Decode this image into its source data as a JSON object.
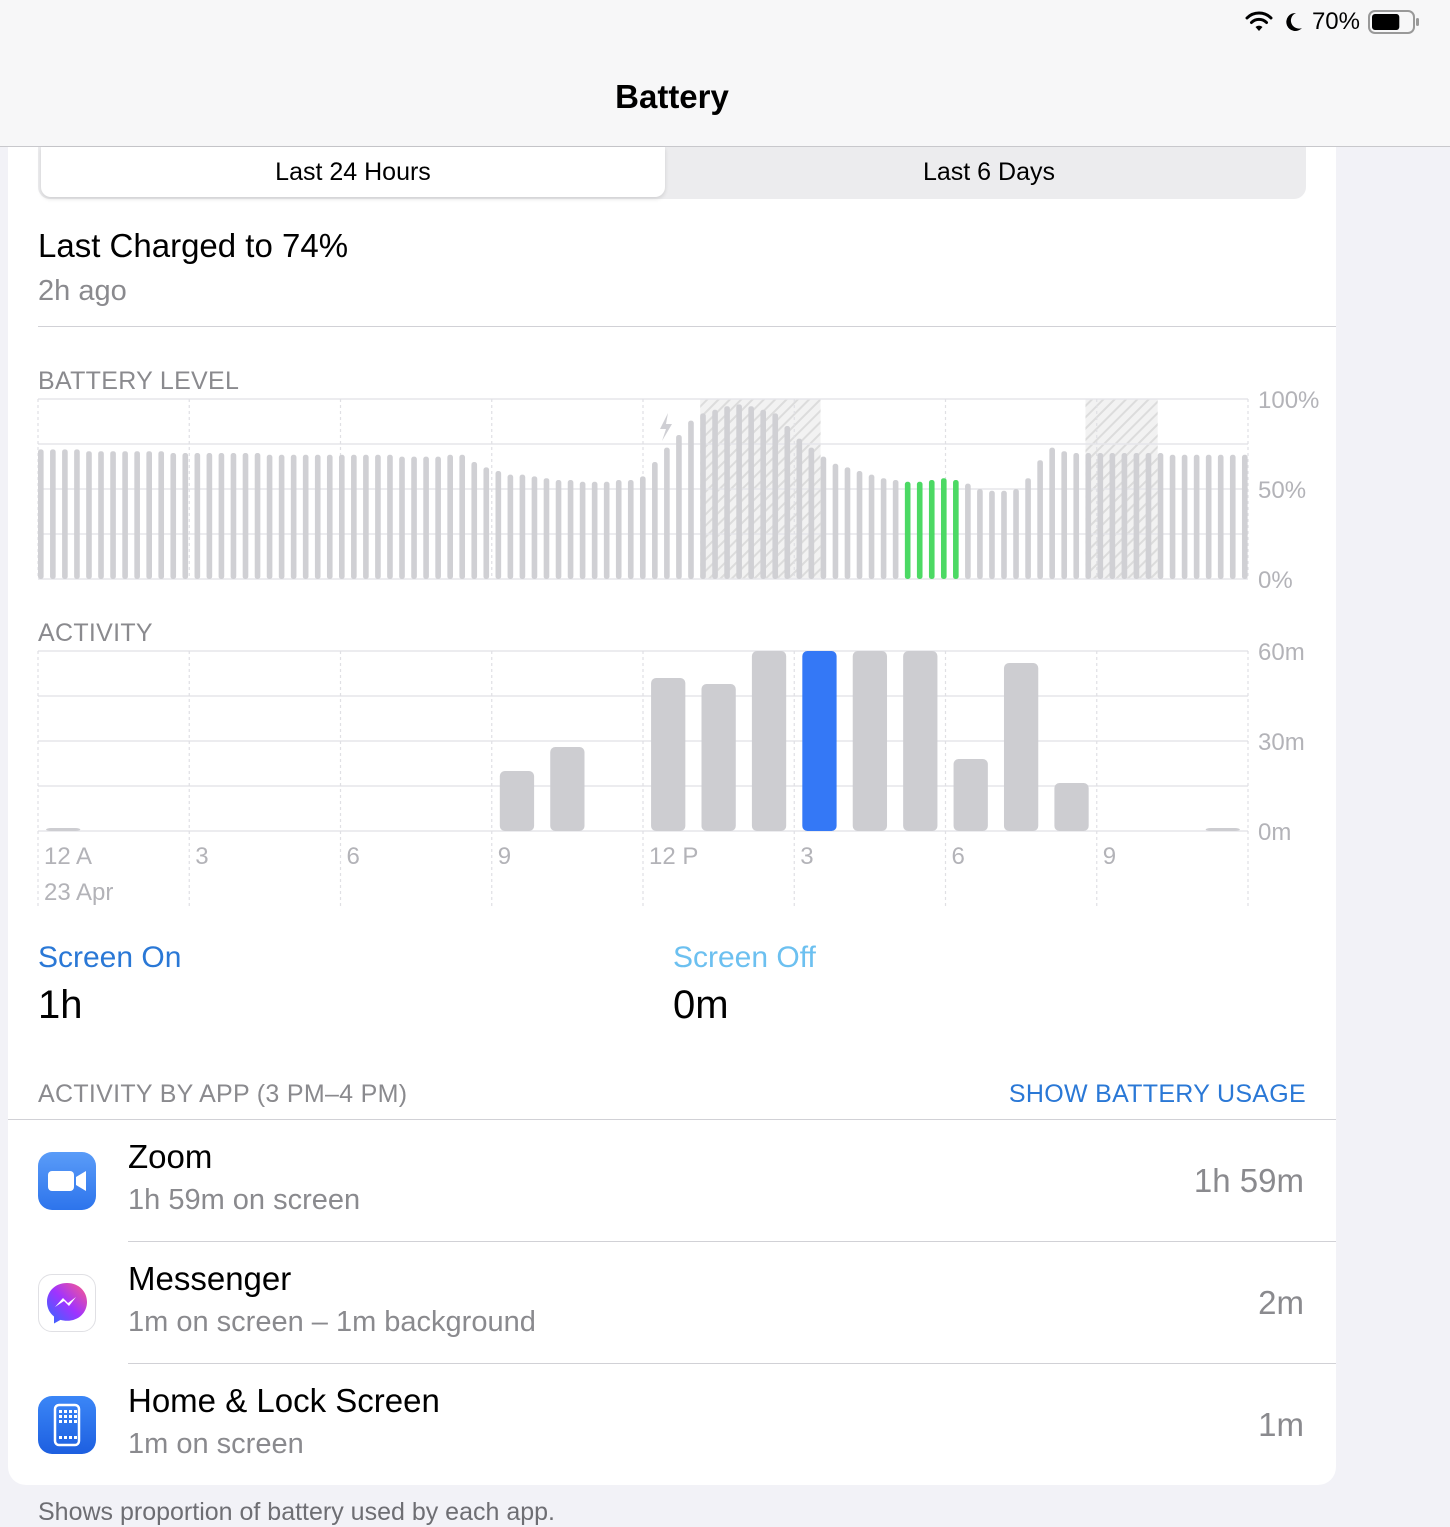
{
  "status_bar": {
    "battery_percent": "70%",
    "battery_level": 0.7,
    "icons": [
      "wifi-icon",
      "moon-icon",
      "battery-icon"
    ]
  },
  "navbar": {
    "title": "Battery"
  },
  "segments": {
    "active": "Last 24 Hours",
    "inactive": "Last 6 Days"
  },
  "last_charged": {
    "title": "Last Charged to 74%",
    "subtitle": "2h ago"
  },
  "battery_level": {
    "label": "BATTERY LEVEL",
    "y_ticks": [
      "100%",
      "50%",
      "0%"
    ]
  },
  "activity": {
    "label": "ACTIVITY",
    "y_ticks": [
      "60m",
      "30m",
      "0m"
    ],
    "x_ticks": [
      "12 A",
      "3",
      "6",
      "9",
      "12 P",
      "3",
      "6",
      "9"
    ],
    "date_label": "23 Apr"
  },
  "chart_data": [
    {
      "type": "bar",
      "name": "battery_level",
      "ylim": [
        0,
        100
      ],
      "unit": "%",
      "values": [
        72,
        72,
        72,
        72,
        72,
        72,
        72,
        71,
        71,
        71,
        71,
        71,
        71,
        71,
        71,
        71,
        71,
        71,
        71,
        71,
        71,
        71,
        70,
        70,
        70,
        70,
        70,
        70,
        70,
        70,
        70,
        70,
        70,
        70,
        70,
        70,
        70,
        70,
        69,
        69,
        69,
        69,
        69,
        69,
        69,
        69,
        69,
        69,
        69,
        69,
        69,
        69,
        69,
        69,
        69,
        69,
        69,
        69,
        69,
        69,
        68,
        68,
        68,
        68,
        68,
        68,
        68,
        68,
        69,
        69,
        69,
        67,
        65,
        63,
        62,
        61,
        60,
        59,
        58,
        58,
        58,
        57,
        57,
        57,
        56,
        56,
        55,
        55,
        55,
        55,
        54,
        54,
        54,
        54,
        54,
        55,
        55,
        55,
        55,
        56,
        57,
        59,
        65,
        70,
        73,
        76,
        80,
        85,
        88,
        90,
        92,
        93,
        94,
        95,
        96,
        97,
        97,
        97,
        96,
        95,
        94,
        93,
        92,
        90,
        85,
        80,
        78,
        76,
        73,
        70,
        68,
        65,
        64,
        63,
        62,
        61,
        60,
        59,
        58,
        57,
        56,
        55,
        55,
        55,
        54,
        54,
        54,
        54,
        55,
        55,
        56,
        56,
        55,
        54,
        53,
        51,
        50,
        49,
        49,
        49,
        49,
        49,
        50,
        52,
        56,
        60,
        66,
        72,
        73,
        72,
        71,
        70,
        70,
        70,
        70,
        70,
        70,
        70,
        70,
        70,
        70,
        70,
        70,
        70,
        70,
        70,
        70,
        69,
        69,
        69,
        69,
        69,
        69,
        69,
        69,
        69,
        69,
        69,
        69,
        69,
        69
      ],
      "highlight_range": [
        143,
        153
      ],
      "highlight_color": "#4cd964",
      "charging_periods": [
        [
          110,
          130
        ],
        [
          174,
          186
        ]
      ]
    },
    {
      "type": "bar",
      "name": "activity",
      "ylim": [
        0,
        60
      ],
      "unit": "min",
      "categories": [
        "0",
        "1",
        "2",
        "3",
        "4",
        "5",
        "6",
        "7",
        "8",
        "9",
        "10",
        "11",
        "12",
        "13",
        "14",
        "15",
        "16",
        "17",
        "18",
        "19",
        "20",
        "21",
        "22",
        "23"
      ],
      "values": [
        1,
        0,
        0,
        0,
        0,
        0,
        0,
        0,
        0,
        20,
        28,
        0,
        51,
        49,
        60,
        60,
        60,
        60,
        24,
        56,
        16,
        0,
        0,
        1
      ],
      "highlight_index": 15,
      "highlight_color": "#3478f6"
    }
  ],
  "screen": {
    "on_label": "Screen On",
    "on_value": "1h",
    "off_label": "Screen Off",
    "off_value": "0m"
  },
  "activity_by_app": {
    "header": "ACTIVITY BY APP (3 PM–4 PM)",
    "action": "SHOW BATTERY USAGE",
    "apps": [
      {
        "name": "Zoom",
        "detail": "1h 59m on screen",
        "time": "1h 59m",
        "icon": "zoom-icon"
      },
      {
        "name": "Messenger",
        "detail": "1m on screen – 1m background",
        "time": "2m",
        "icon": "messenger-icon"
      },
      {
        "name": "Home & Lock Screen",
        "detail": "1m on screen",
        "time": "1m",
        "icon": "home-lock-icon"
      }
    ]
  },
  "footer": "Shows proportion of battery used by each app."
}
